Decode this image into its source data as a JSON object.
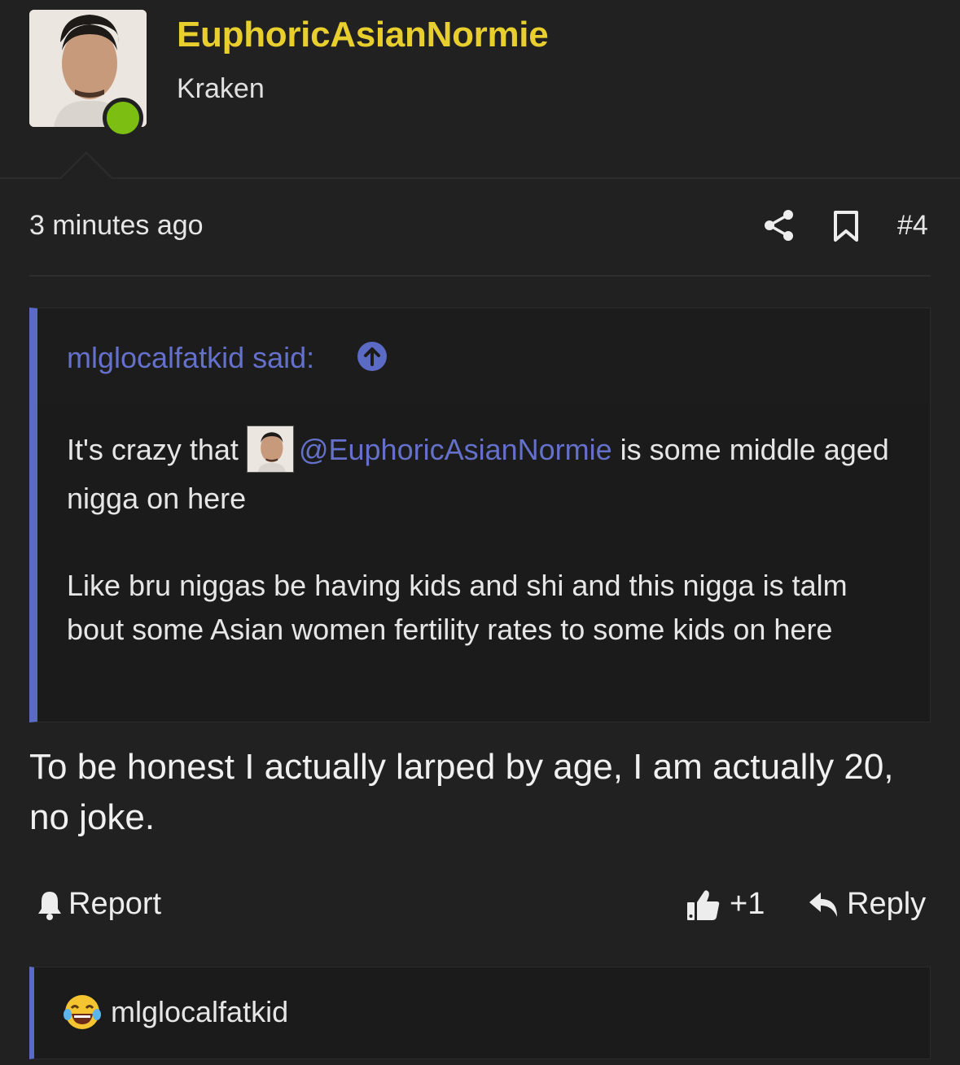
{
  "header": {
    "username": "EuphoricAsianNormie",
    "user_title": "Kraken"
  },
  "post": {
    "time": "3 minutes ago",
    "number": "#4",
    "quote": {
      "author_label": "mlglocalfatkid said:",
      "text_before": "It's crazy that ",
      "mention": "@EuphoricAsianNormie",
      "text_after": " is some middle aged nigga on here",
      "paragraph2": "Like bru niggas be having kids and shi and this nigga is talm bout some Asian women fertility rates to some kids on here"
    },
    "message": "To be honest I actually larped by age, I am actually 20, no joke.",
    "actions": {
      "report": "Report",
      "like_count": "+1",
      "reply": "Reply"
    },
    "reactions": {
      "user": "mlglocalfatkid"
    }
  },
  "colors": {
    "username": "#e8cf2e",
    "link": "#6470c9",
    "online": "#7cbf12",
    "background": "#212121"
  }
}
